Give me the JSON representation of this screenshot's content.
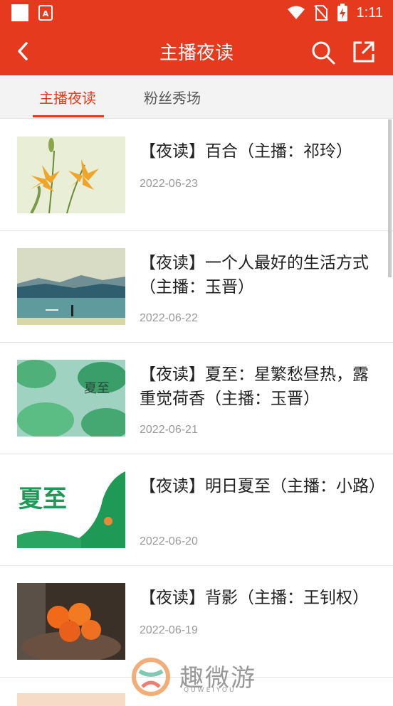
{
  "status": {
    "time": "1:11",
    "app_icon_label": "A"
  },
  "toolbar": {
    "title": "主播夜读"
  },
  "tabs": [
    {
      "label": "主播夜读"
    },
    {
      "label": "粉丝秀场"
    }
  ],
  "items": [
    {
      "title": "【夜读】百合（主播：祁玲）",
      "date": "2022-06-23"
    },
    {
      "title": "【夜读】一个人最好的生活方式（主播：玉晋）",
      "date": "2022-06-22"
    },
    {
      "title": "【夜读】夏至：星繁愁昼热，露重觉荷香（主播：玉晋）",
      "date": "2022-06-21",
      "thumb_text": "夏至"
    },
    {
      "title": "【夜读】明日夏至（主播：小路）",
      "date": "2022-06-20",
      "thumb_text": "夏至"
    },
    {
      "title": "【夜读】背影（主播：王钊权）",
      "date": "2022-06-19"
    }
  ],
  "watermark": {
    "name": "趣微游",
    "sub": "QUWEIYOU"
  }
}
